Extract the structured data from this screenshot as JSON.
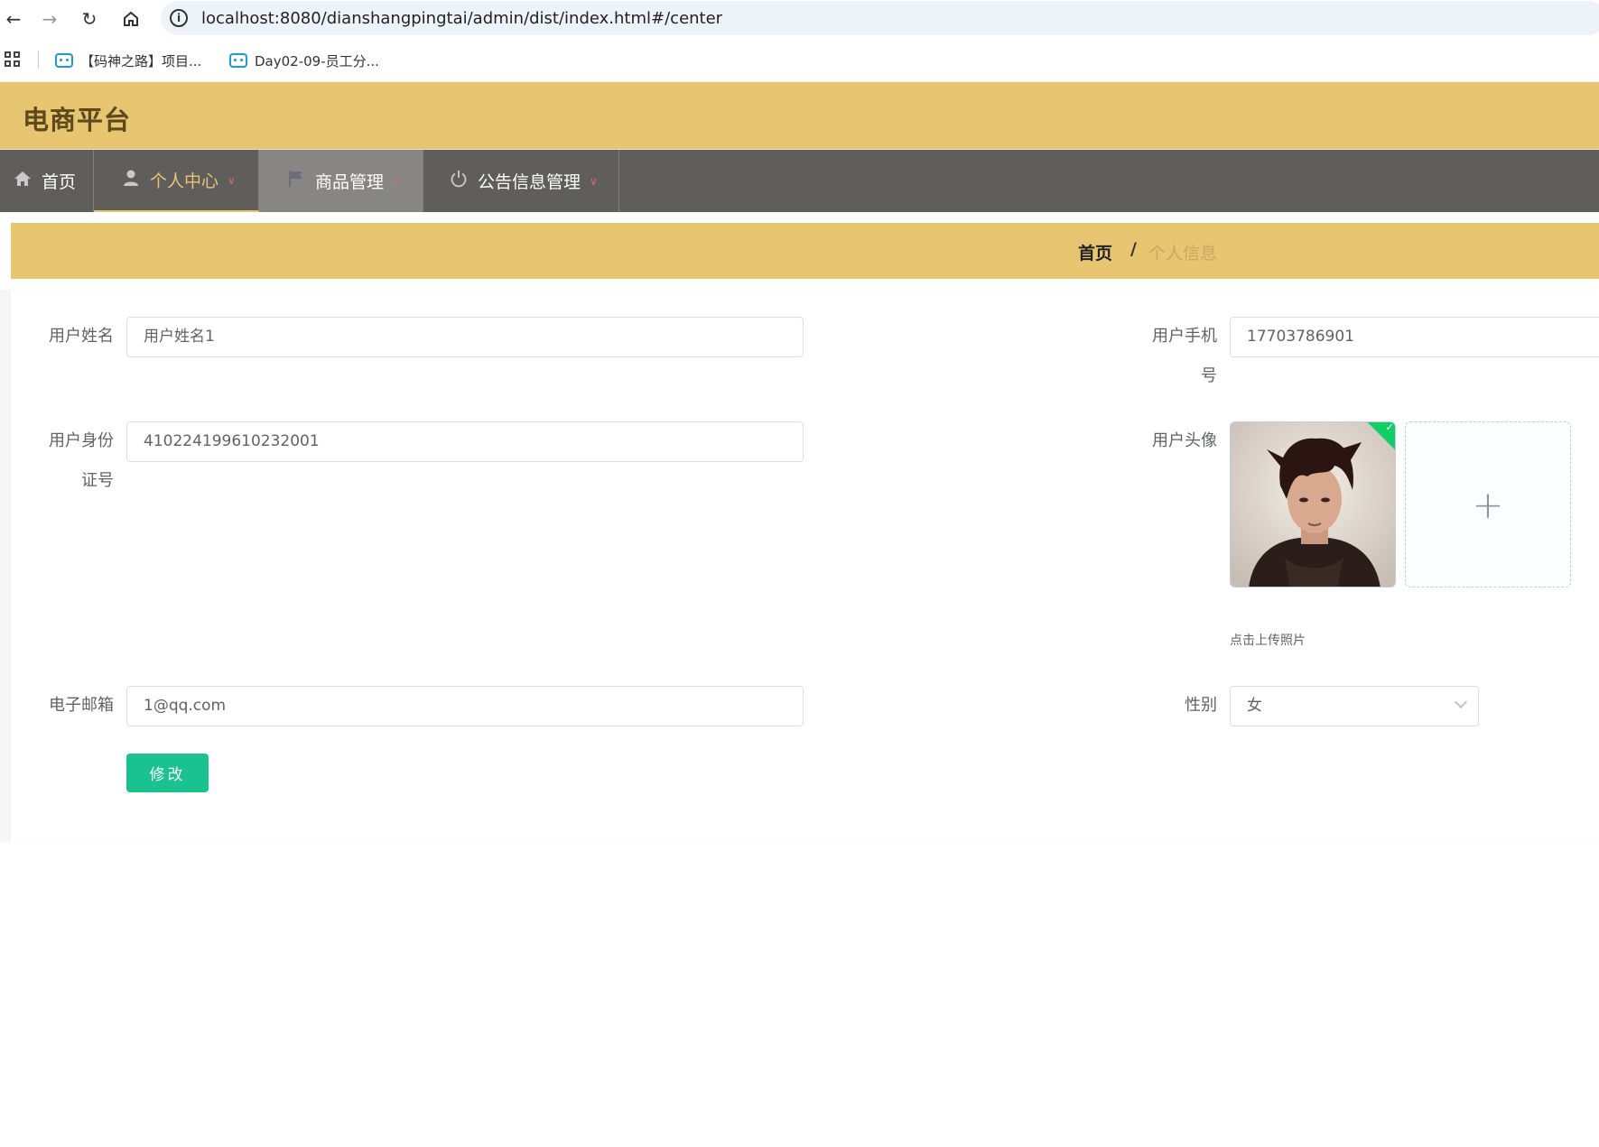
{
  "browser": {
    "url": "localhost:8080/dianshangpingtai/admin/dist/index.html#/center",
    "bookmarks": [
      {
        "label": "【码神之路】项目..."
      },
      {
        "label": "Day02-09-员工分..."
      }
    ]
  },
  "app": {
    "title": "电商平台"
  },
  "menu": {
    "items": [
      {
        "label": "首页",
        "icon": "home-icon"
      },
      {
        "label": "个人中心",
        "icon": "user-icon"
      },
      {
        "label": "商品管理",
        "icon": "flag-icon"
      },
      {
        "label": "公告信息管理",
        "icon": "power-icon"
      }
    ]
  },
  "breadcrumb": {
    "home": "首页",
    "separator": "/",
    "current": "个人信息"
  },
  "form": {
    "username": {
      "label": "用户姓名",
      "value": "用户姓名1"
    },
    "phone": {
      "label_line1": "用户手机",
      "label_line2": "号",
      "value": "17703786901"
    },
    "idcard": {
      "label_line1": "用户身份",
      "label_line2": "证号",
      "value": "410224199610232001"
    },
    "avatar": {
      "label": "用户头像",
      "upload_tip": "点击上传照片",
      "plus": "+"
    },
    "email": {
      "label": "电子邮箱",
      "value": "1@qq.com"
    },
    "gender": {
      "label": "性别",
      "value": "女"
    },
    "submit_label": "修改"
  },
  "colors": {
    "header": "#e8c570",
    "menubar": "#5f5e5d",
    "submit": "#19c28f",
    "success": "#13ce66"
  }
}
